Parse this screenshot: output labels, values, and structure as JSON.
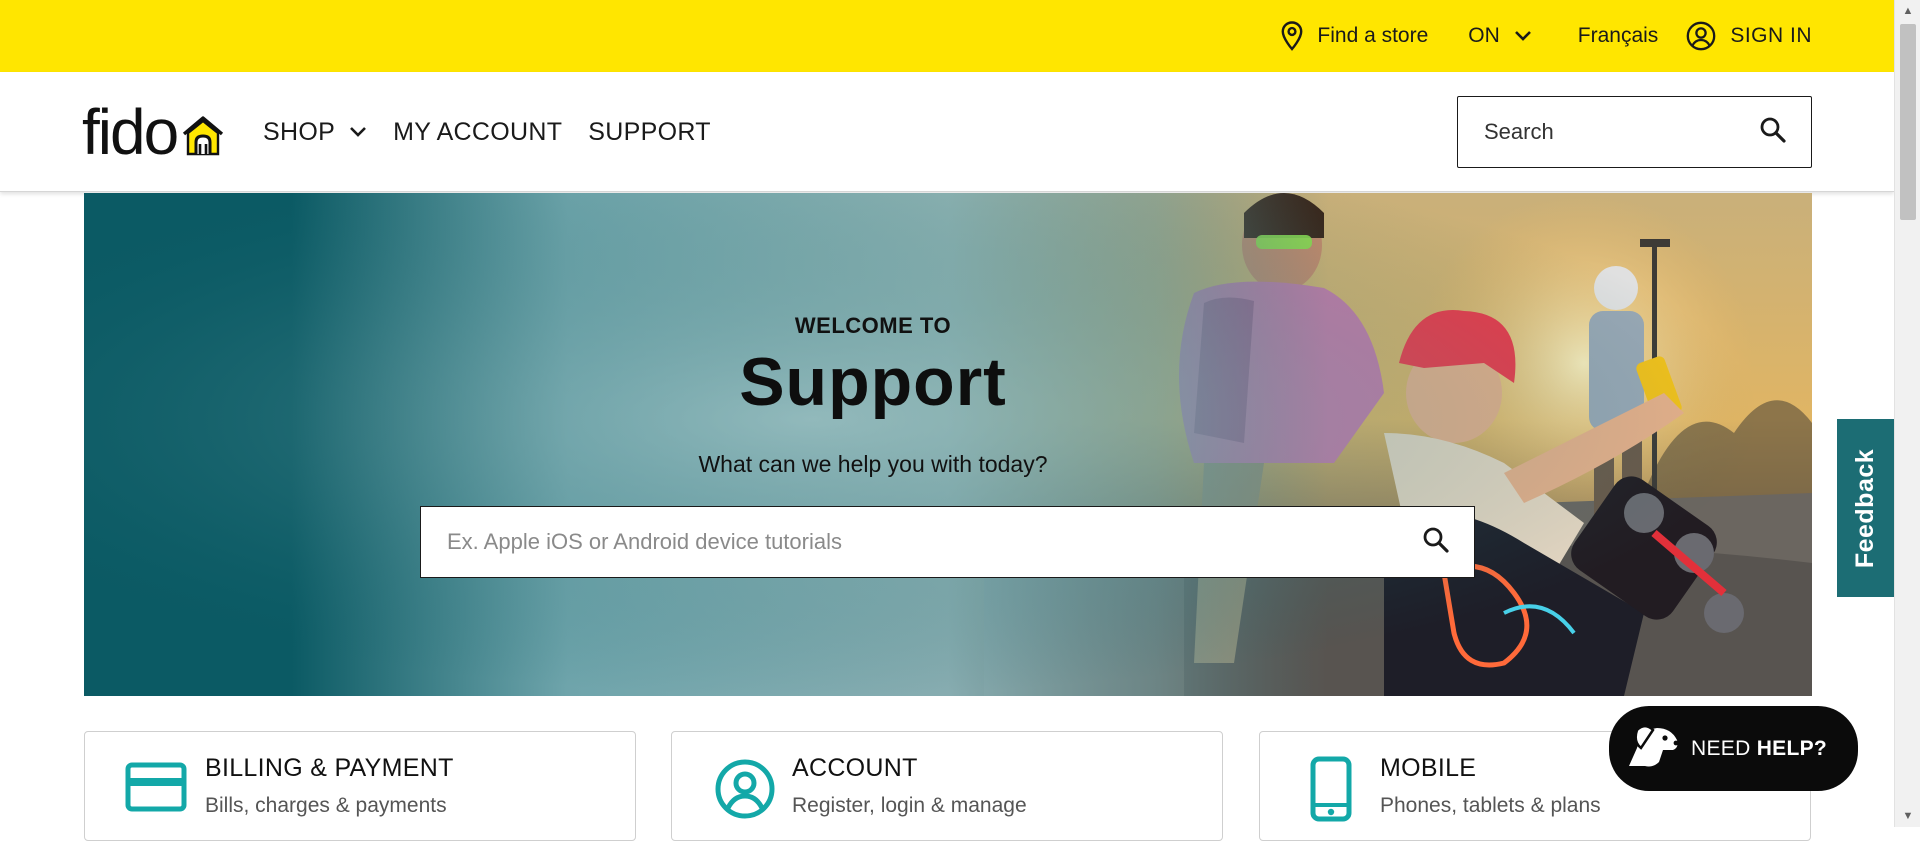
{
  "topbar": {
    "find_store": "Find a store",
    "province": "ON",
    "language": "Français",
    "sign_in": "SIGN IN"
  },
  "header": {
    "logo_text": "fido",
    "nav": {
      "shop": "SHOP",
      "my_account": "MY ACCOUNT",
      "support": "SUPPORT"
    },
    "search_placeholder": "Search"
  },
  "hero": {
    "eyebrow": "WELCOME TO",
    "title": "Support",
    "subtitle": "What can we help you with today?",
    "search_placeholder": "Ex. Apple iOS or Android device tutorials"
  },
  "cards": [
    {
      "title": "BILLING & PAYMENT",
      "subtitle": "Bills, charges & payments",
      "icon": "credit-card-icon"
    },
    {
      "title": "ACCOUNT",
      "subtitle": "Register, login & manage",
      "icon": "user-circle-icon"
    },
    {
      "title": "MOBILE",
      "subtitle": "Phones, tablets & plans",
      "icon": "smartphone-icon"
    }
  ],
  "feedback_label": "Feedback",
  "need_help": {
    "prefix": "NEED ",
    "bold": "HELP?"
  },
  "colors": {
    "brand_yellow": "#ffe600",
    "hero_teal": "#0d5e68",
    "icon_teal": "#13a8a8",
    "feedback_teal": "#1c6d74"
  }
}
